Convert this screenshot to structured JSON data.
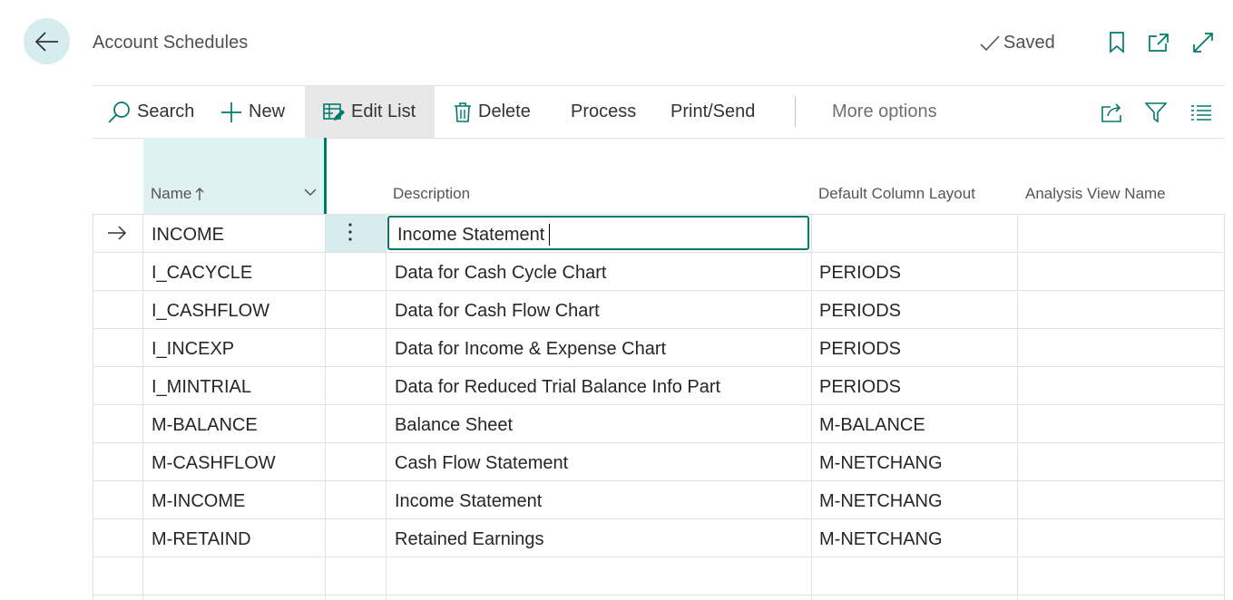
{
  "page": {
    "title": "Account Schedules",
    "saved_label": "Saved"
  },
  "icons": {
    "back": "arrow-left-icon",
    "saved": "checkmark-icon",
    "bookmark": "bookmark-icon",
    "open_new": "open-in-new-window-icon",
    "expand": "expand-icon",
    "search": "search-icon",
    "new": "plus-icon",
    "edit_list": "edit-list-icon",
    "delete": "trash-icon",
    "share": "share-icon",
    "filter": "filter-icon",
    "list_view": "list-view-icon",
    "row_pointer": "arrow-right-icon",
    "row_menu": "vertical-ellipsis-icon",
    "sort": "sort-ascending-icon",
    "column_menu": "chevron-down-icon"
  },
  "actions": {
    "search": "Search",
    "new": "New",
    "edit_list": "Edit List",
    "delete": "Delete",
    "process": "Process",
    "print_send": "Print/Send",
    "more_options": "More options"
  },
  "columns": {
    "name": "Name",
    "description": "Description",
    "default_column_layout": "Default Column Layout",
    "analysis_view_name": "Analysis View Name"
  },
  "rows": [
    {
      "name": "INCOME",
      "description": "Income Statement",
      "layout": "",
      "analysis": ""
    },
    {
      "name": "I_CACYCLE",
      "description": "Data for Cash Cycle Chart",
      "layout": "PERIODS",
      "analysis": ""
    },
    {
      "name": "I_CASHFLOW",
      "description": "Data for Cash Flow Chart",
      "layout": "PERIODS",
      "analysis": ""
    },
    {
      "name": "I_INCEXP",
      "description": "Data for Income & Expense Chart",
      "layout": "PERIODS",
      "analysis": ""
    },
    {
      "name": "I_MINTRIAL",
      "description": "Data for Reduced Trial Balance Info Part",
      "layout": "PERIODS",
      "analysis": ""
    },
    {
      "name": "M-BALANCE",
      "description": "Balance Sheet",
      "layout": "M-BALANCE",
      "analysis": ""
    },
    {
      "name": "M-CASHFLOW",
      "description": "Cash Flow Statement",
      "layout": "M-NETCHANG",
      "analysis": ""
    },
    {
      "name": "M-INCOME",
      "description": "Income Statement",
      "layout": "M-NETCHANG",
      "analysis": ""
    },
    {
      "name": "M-RETAIND",
      "description": "Retained Earnings",
      "layout": "M-NETCHANG",
      "analysis": ""
    }
  ],
  "colors": {
    "accent": "#00796b",
    "selection_bg": "#d6ecef",
    "name_header_bg": "#dff1f3"
  }
}
